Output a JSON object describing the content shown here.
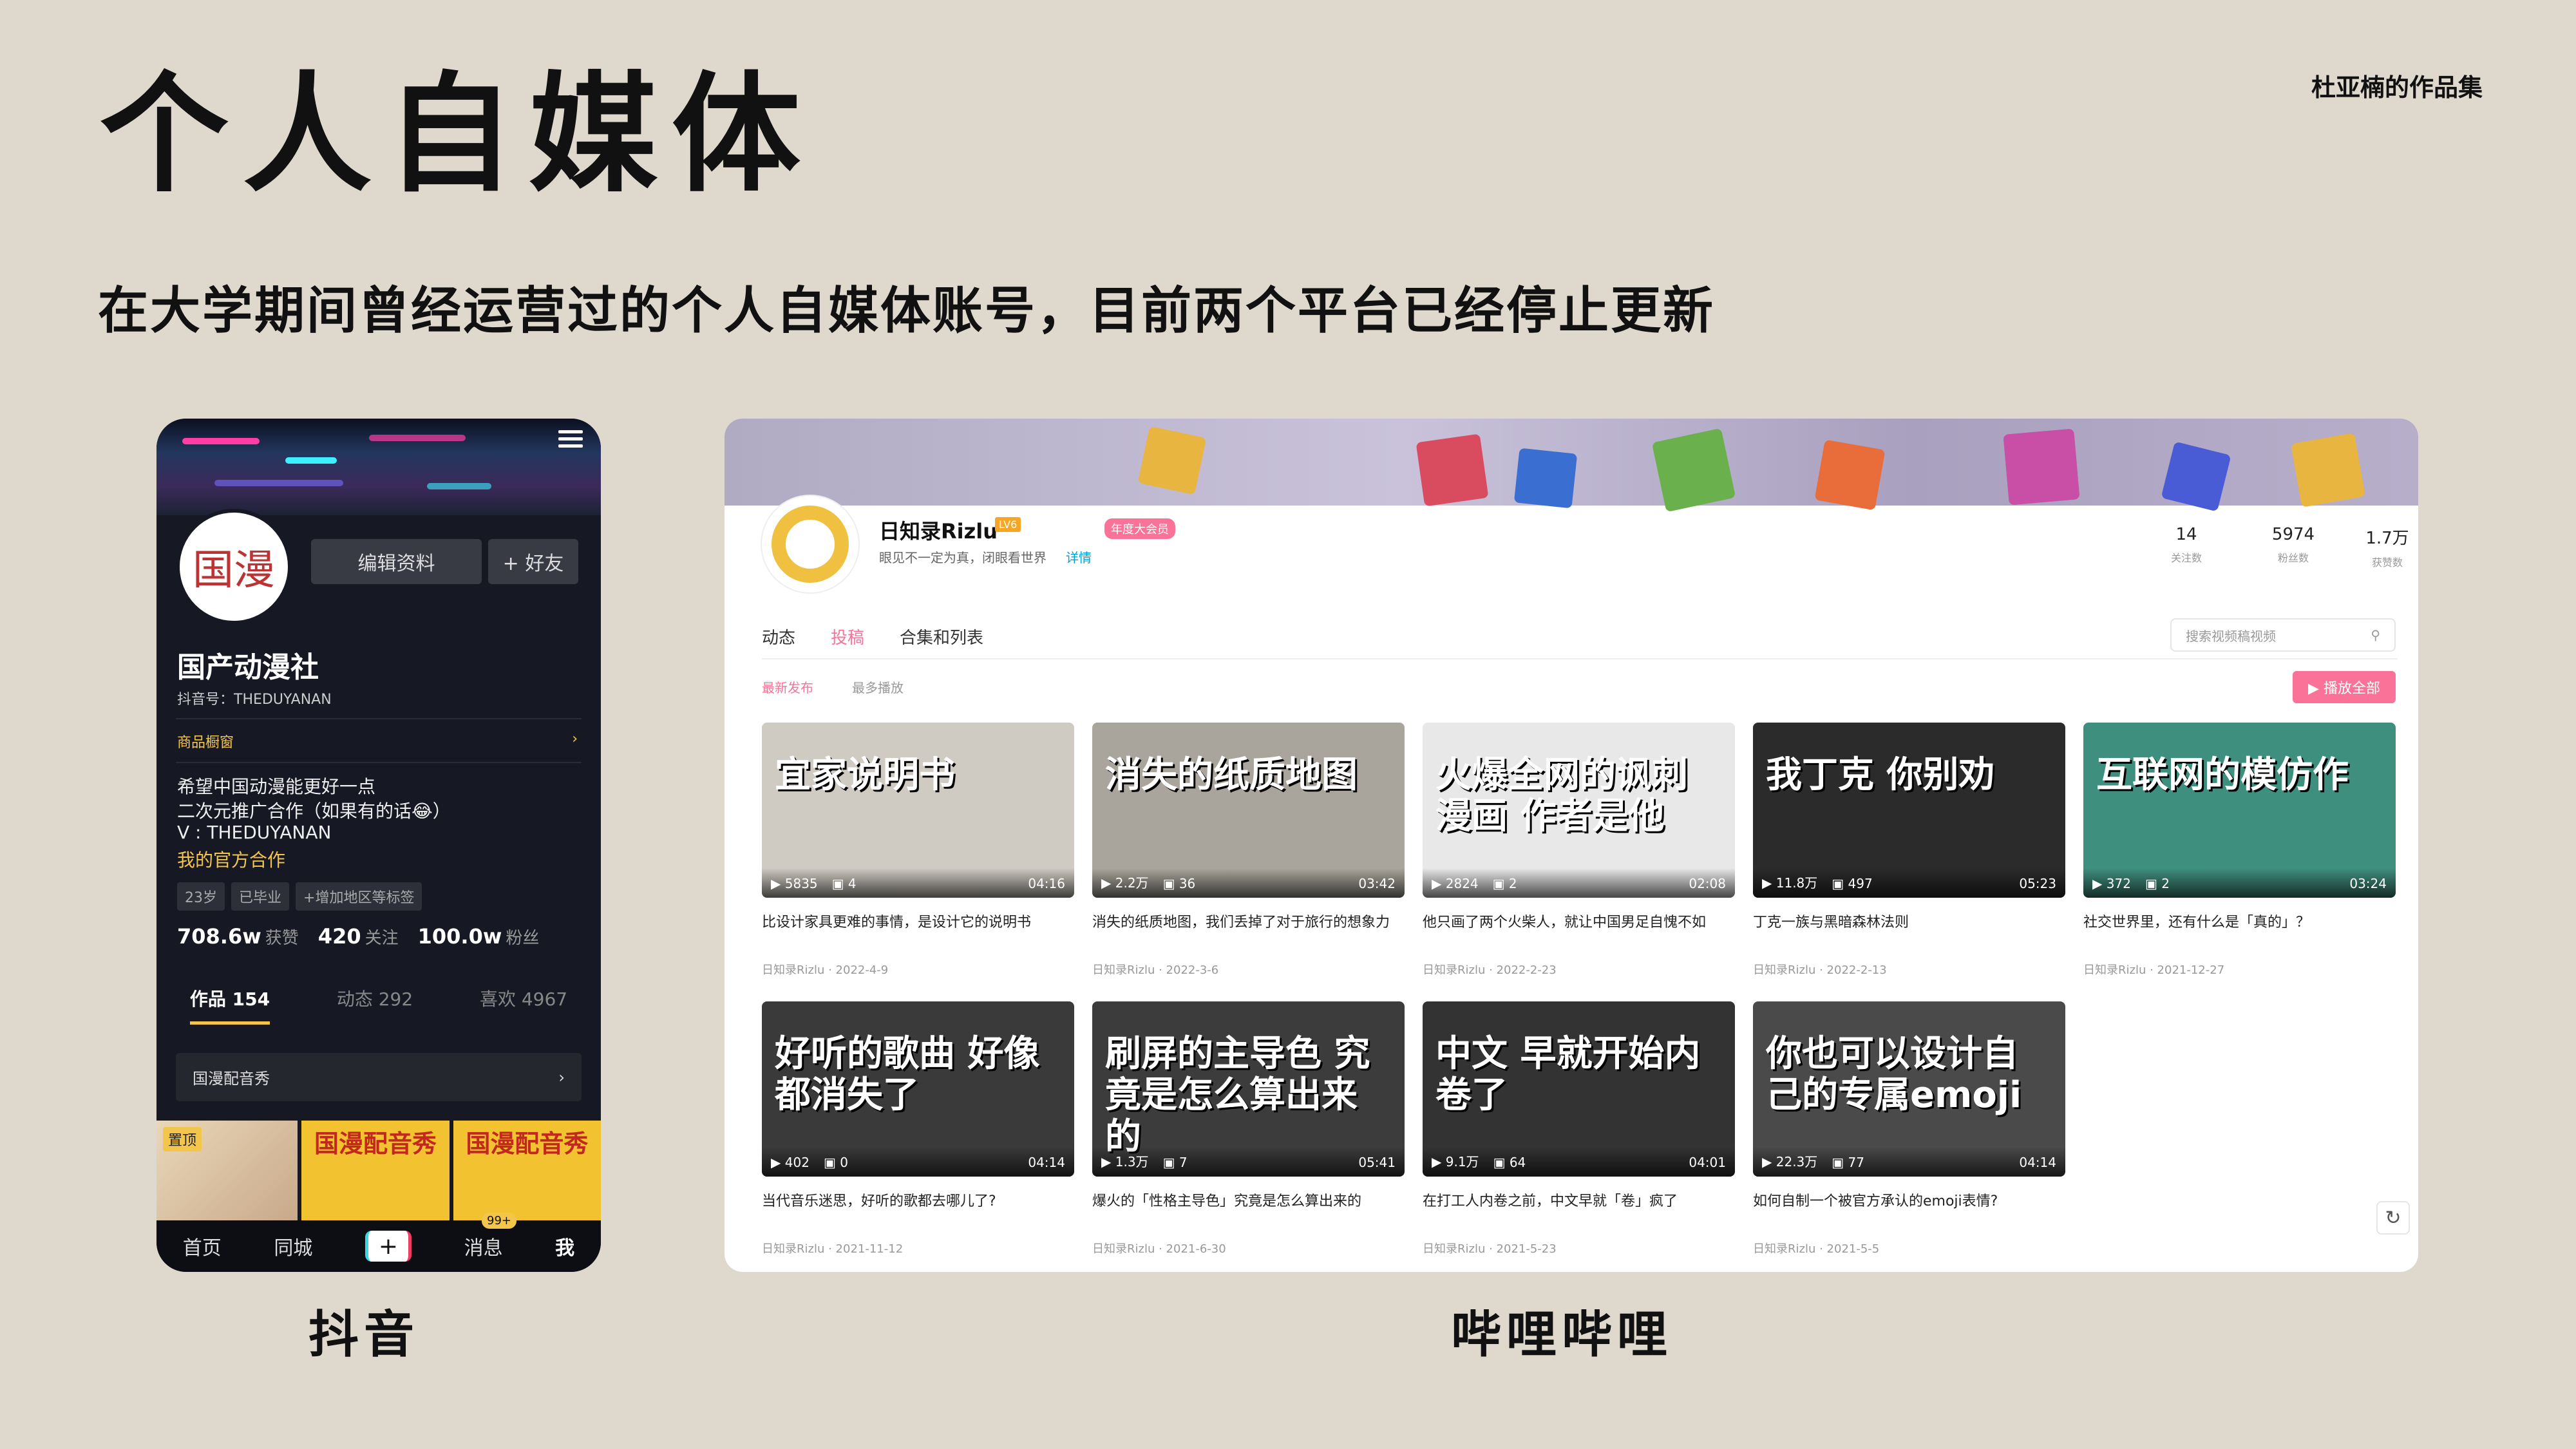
{
  "slide": {
    "title": "个人自媒体",
    "author": "杜亚楠的作品集",
    "subtitle": "在大学期间曾经运营过的个人自媒体账号，目前两个平台已经停止更新",
    "caption_douyin": "抖音",
    "caption_bilibili": "哔哩哔哩"
  },
  "douyin": {
    "avatar_text": "国漫",
    "edit_profile": "编辑资料",
    "add_friend": "+ 好友",
    "name": "国产动漫社",
    "douyin_id": "抖音号：THEDUYANAN",
    "shop": "商品橱窗",
    "shop_arrow": "›",
    "bio": [
      "希望中国动漫能更好一点",
      "二次元推广合作（如果有的话😂）",
      "V : THEDUYANAN",
      "我的官方合作"
    ],
    "tags": [
      "23岁",
      "已毕业",
      "+增加地区等标签"
    ],
    "stats": {
      "likes": "708.6w",
      "likes_label": "获赞",
      "following": "420",
      "following_label": "关注",
      "fans": "100.0w",
      "fans_label": "粉丝"
    },
    "tabs": [
      "作品 154",
      "动态 292",
      "喜欢 4967"
    ],
    "playlist": "国漫配音秀",
    "playlist_arrow": "›",
    "pinned": "置顶",
    "thumb_texts": [
      "国漫配音秀",
      "国漫配音秀"
    ],
    "nav": [
      "首页",
      "同城",
      "+",
      "消息",
      "我"
    ],
    "msg_badge": "99+",
    "colors": {
      "bg": "#161823",
      "accent": "#f3c54b"
    }
  },
  "bilibili": {
    "name": "日知录Rizlu",
    "level": "LV6",
    "vip": "年度大会员",
    "sign": "眼见不一定为真，闭眼看世界",
    "sign_more": "详情",
    "stats": [
      {
        "value": "14",
        "label": "关注数"
      },
      {
        "value": "5974",
        "label": "粉丝数"
      },
      {
        "value": "1.7万",
        "label": "获赞数"
      }
    ],
    "tabs": [
      "动态",
      "投稿",
      "合集和列表"
    ],
    "search_placeholder": "搜索视频稿视频",
    "sort": [
      "最新发布",
      "最多播放"
    ],
    "play_all": "▶ 播放全部",
    "colors": {
      "accent": "#fb7299",
      "link": "#00a1d6"
    },
    "videos": [
      {
        "thumb_text": "宜家说明书",
        "views": "5835",
        "comments": "4",
        "duration": "04:16",
        "title": "比设计家具更难的事情，是设计它的说明书",
        "uploader": "日知录Rizlu",
        "date": "2022-4-9",
        "bg": "#cfcac2"
      },
      {
        "thumb_text": "消失的纸质地图",
        "views": "2.2万",
        "comments": "36",
        "duration": "03:42",
        "title": "消失的纸质地图，我们丢掉了对于旅行的想象力",
        "uploader": "日知录Rizlu",
        "date": "2022-3-6",
        "bg": "#a9a59c"
      },
      {
        "thumb_text": "火爆全网的讽刺漫画 作者是他",
        "views": "2824",
        "comments": "2",
        "duration": "02:08",
        "title": "他只画了两个火柴人，就让中国男足自愧不如",
        "uploader": "日知录Rizlu",
        "date": "2022-2-23",
        "bg": "#e8e8e8"
      },
      {
        "thumb_text": "我丁克 你别劝",
        "views": "11.8万",
        "comments": "497",
        "duration": "05:23",
        "title": "丁克一族与黑暗森林法则",
        "uploader": "日知录Rizlu",
        "date": "2022-2-13",
        "bg": "#2b2b2b"
      },
      {
        "thumb_text": "互联网的模仿作",
        "views": "372",
        "comments": "2",
        "duration": "03:24",
        "title": "社交世界里，还有什么是「真的」？",
        "uploader": "日知录Rizlu",
        "date": "2021-12-27",
        "bg": "#3f8f7e"
      },
      {
        "thumb_text": "好听的歌曲 好像都消失了",
        "views": "402",
        "comments": "0",
        "duration": "04:14",
        "title": "当代音乐迷思，好听的歌都去哪儿了?",
        "uploader": "日知录Rizlu",
        "date": "2021-11-12",
        "bg": "#3a3a3a"
      },
      {
        "thumb_text": "刷屏的主导色 究竟是怎么算出来的",
        "views": "1.3万",
        "comments": "7",
        "duration": "05:41",
        "title": "爆火的「性格主导色」究竟是怎么算出来的",
        "uploader": "日知录Rizlu",
        "date": "2021-6-30",
        "bg": "#3c3c3c"
      },
      {
        "thumb_text": "中文 早就开始内卷了",
        "views": "9.1万",
        "comments": "64",
        "duration": "04:01",
        "title": "在打工人内卷之前，中文早就「卷」疯了",
        "uploader": "日知录Rizlu",
        "date": "2021-5-23",
        "bg": "#333333"
      },
      {
        "thumb_text": "你也可以设计自己的专属emoji",
        "views": "22.3万",
        "comments": "77",
        "duration": "04:14",
        "title": "如何自制一个被官方承认的emoji表情?",
        "uploader": "日知录Rizlu",
        "date": "2021-5-5",
        "bg": "#4a4a4a"
      }
    ],
    "refresh_icon": "↻"
  }
}
